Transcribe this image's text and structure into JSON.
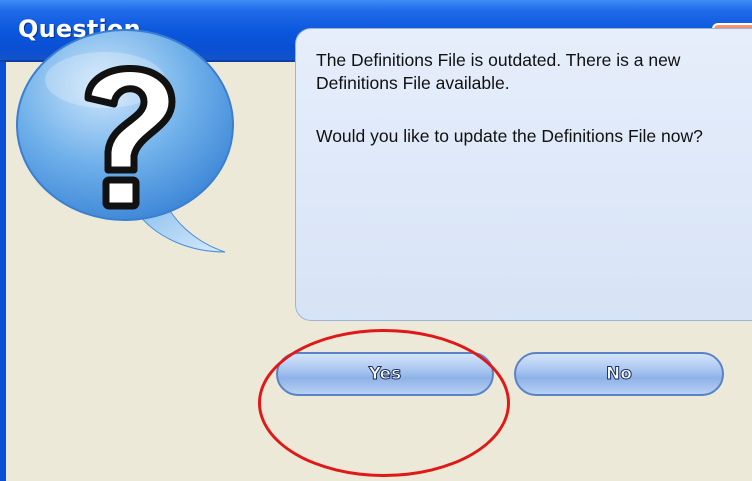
{
  "window": {
    "title": "Question",
    "close_icon": "close-icon"
  },
  "icon": {
    "name": "question-bubble-icon"
  },
  "message": {
    "line1": "The Definitions File is outdated. There is a new Definitions File available.",
    "line2": "Would you like to update the Definitions File now?"
  },
  "buttons": {
    "yes_label": "Yes",
    "no_label": "No"
  },
  "annotation": {
    "highlight_color": "#e01818"
  }
}
